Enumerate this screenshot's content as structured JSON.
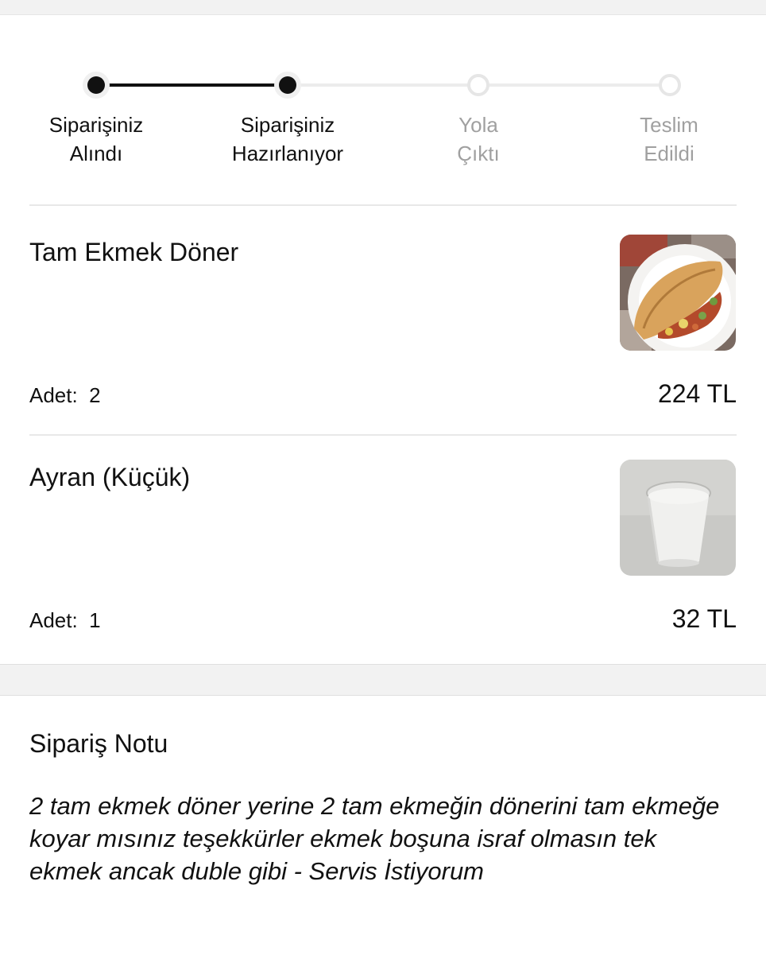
{
  "progress": {
    "steps": [
      {
        "line1": "Siparişiniz",
        "line2": "Alındı",
        "state": "done"
      },
      {
        "line1": "Siparişiniz",
        "line2": "Hazırlanıyor",
        "state": "done"
      },
      {
        "line1": "Yola",
        "line2": "Çıktı",
        "state": "pending"
      },
      {
        "line1": "Teslim",
        "line2": "Edildi",
        "state": "pending"
      }
    ],
    "completed_count": 2
  },
  "items": [
    {
      "name": "Tam Ekmek Döner",
      "qty_label": "Adet:",
      "qty": "2",
      "price": "224 TL",
      "image_icon": "doner-sandwich-photo"
    },
    {
      "name": "Ayran (Küçük)",
      "qty_label": "Adet:",
      "qty": "1",
      "price": "32 TL",
      "image_icon": "ayran-cup-photo"
    }
  ],
  "note": {
    "title": "Sipariş Notu",
    "text": "2 tam ekmek döner yerine 2 tam ekmeğin dönerini tam ekmeğe koyar mısınız teşekkürler ekmek boşuna israf olmasın tek ekmek ancak duble gibi - Servis İstiyorum"
  },
  "colors": {
    "active": "#111111",
    "inactive": "#a0a0a0",
    "track_inactive": "#ececec"
  }
}
